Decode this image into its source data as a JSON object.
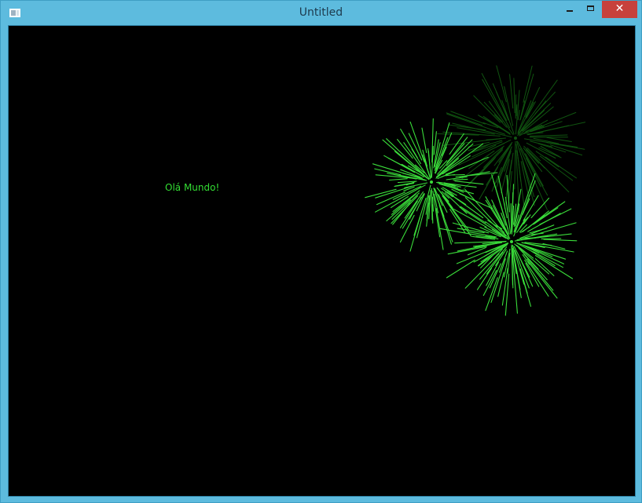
{
  "window": {
    "title": "Untitled",
    "controls": {
      "minimize_icon": "minimize-icon",
      "maximize_icon": "maximize-icon",
      "close_glyph": "✕"
    },
    "frame_color": "#5dbbde",
    "close_color": "#c7413c"
  },
  "canvas": {
    "background": "#000000",
    "greeting": "Olá Mundo!",
    "greeting_color": "#33dd33",
    "fireworks": [
      {
        "name": "firework-dim-upper",
        "color": "#1e9a1e"
      },
      {
        "name": "firework-left",
        "color": "#3ee83e"
      },
      {
        "name": "firework-lower",
        "color": "#3ee83e"
      }
    ]
  }
}
